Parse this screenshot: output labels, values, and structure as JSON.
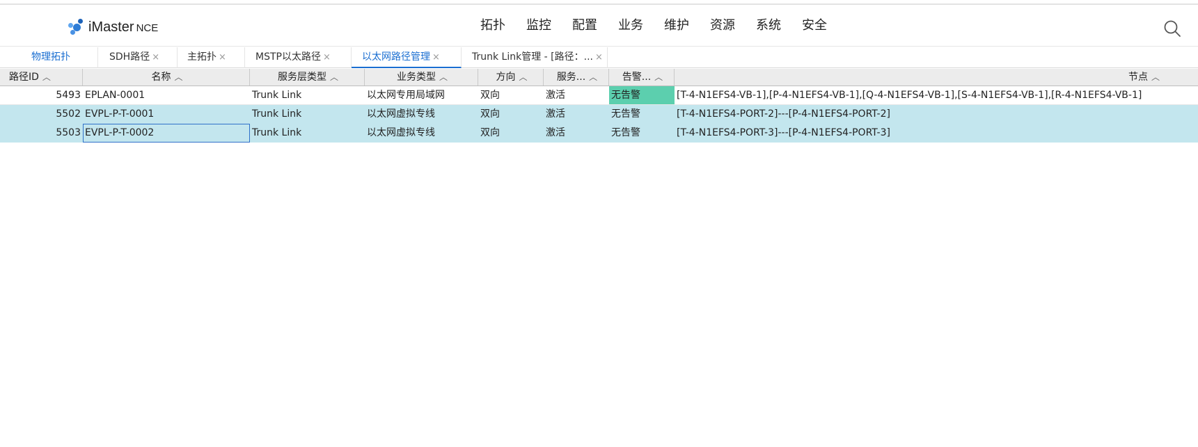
{
  "app": {
    "logo_main": "iMaster",
    "logo_sub": "NCE"
  },
  "nav": [
    "拓扑",
    "监控",
    "配置",
    "业务",
    "维护",
    "资源",
    "系统",
    "安全"
  ],
  "tabs": [
    {
      "label": "物理拓扑",
      "closable": false
    },
    {
      "label": "SDH路径",
      "closable": true
    },
    {
      "label": "主拓扑",
      "closable": true
    },
    {
      "label": "MSTP以太路径",
      "closable": true
    },
    {
      "label": "以太网路径管理",
      "closable": true
    },
    {
      "label": "Trunk Link管理 - [路径：...",
      "closable": true
    }
  ],
  "tab_close_glyph": "×",
  "table": {
    "sort_glyph": "︿",
    "headers": {
      "id": "路径ID",
      "name": "名称",
      "layer": "服务层类型",
      "biz": "业务类型",
      "dir": "方向",
      "svc": "服务...",
      "alarm": "告警...",
      "node": "节点"
    },
    "rows": [
      {
        "id": "5493",
        "name": "EPLAN-0001",
        "layer": "Trunk Link",
        "biz": "以太网专用局域网",
        "dir": "双向",
        "svc": "激活",
        "alarm": "无告警",
        "node": "[T-4-N1EFS4-VB-1],[P-4-N1EFS4-VB-1],[Q-4-N1EFS4-VB-1],[S-4-N1EFS4-VB-1],[R-4-N1EFS4-VB-1]"
      },
      {
        "id": "5502",
        "name": "EVPL-P-T-0001",
        "layer": "Trunk Link",
        "biz": "以太网虚拟专线",
        "dir": "双向",
        "svc": "激活",
        "alarm": "无告警",
        "node": "[T-4-N1EFS4-PORT-2]---[P-4-N1EFS4-PORT-2]"
      },
      {
        "id": "5503",
        "name": "EVPL-P-T-0002",
        "layer": "Trunk Link",
        "biz": "以太网虚拟专线",
        "dir": "双向",
        "svc": "激活",
        "alarm": "无告警",
        "node": "[T-4-N1EFS4-PORT-3]---[P-4-N1EFS4-PORT-3]"
      }
    ]
  },
  "colors": {
    "accent": "#1a6ed1",
    "selected_row": "#c3e6ee",
    "alarm_none": "#5ccfae"
  }
}
